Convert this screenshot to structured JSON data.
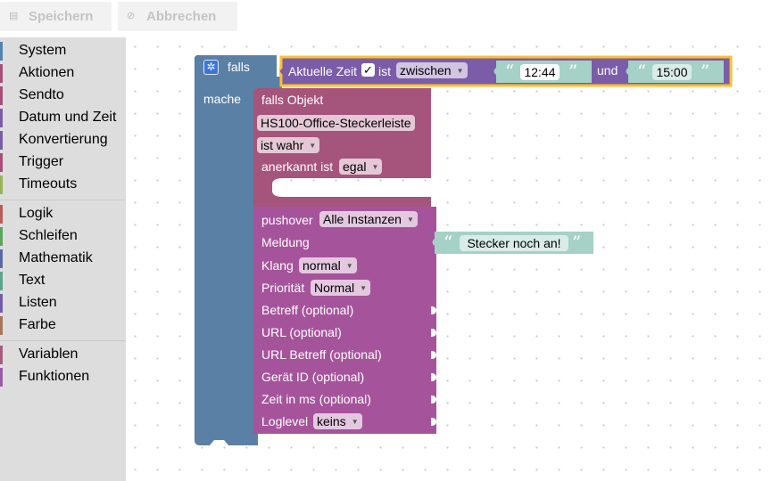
{
  "toolbar": {
    "save_label": "Speichern",
    "cancel_label": "Abbrechen",
    "save_icon": "floppy-icon",
    "cancel_icon": "ban-icon"
  },
  "sidebar": {
    "items": [
      {
        "label": "System",
        "color": "#4f83b0"
      },
      {
        "label": "Aktionen",
        "color": "#a64d79"
      },
      {
        "label": "Sendto",
        "color": "#a64d79"
      },
      {
        "label": "Datum und Zeit",
        "color": "#7a5ca8"
      },
      {
        "label": "Konvertierung",
        "color": "#7a5ca8"
      },
      {
        "label": "Trigger",
        "color": "#a64d79"
      },
      {
        "label": "Timeouts",
        "color": "#98b45b"
      },
      {
        "label": "Logik",
        "color": "#b85c5c"
      },
      {
        "label": "Schleifen",
        "color": "#5ba55b"
      },
      {
        "label": "Mathematik",
        "color": "#5b67a5"
      },
      {
        "label": "Text",
        "color": "#5ba58c"
      },
      {
        "label": "Listen",
        "color": "#745ba5"
      },
      {
        "label": "Farbe",
        "color": "#a5745b"
      },
      {
        "label": "Variablen",
        "color": "#a55b80"
      },
      {
        "label": "Funktionen",
        "color": "#995ba5"
      }
    ]
  },
  "blocks": {
    "if_block": {
      "if_label": "falls",
      "do_label": "mache",
      "color": "#5b80a5"
    },
    "time_compare": {
      "label": "Aktuelle Zeit",
      "check": "✓",
      "is_label": "ist",
      "operator": "zwischen",
      "and_label": "und",
      "start_time": "12:44",
      "end_time": "15:00",
      "color": "#7a5ca8",
      "highlight": "#fcc02e"
    },
    "on_object": {
      "label": "falls Objekt",
      "object_id": "HS100-Office-Steckerleiste",
      "condition": "ist wahr",
      "ack_label": "anerkannt ist",
      "ack_value": "egal",
      "color": "#a5547b"
    },
    "pushover": {
      "label": "pushover",
      "instance": "Alle Instanzen",
      "message_label": "Meldung",
      "message_text": "Stecker noch an!",
      "sound_label": "Klang",
      "sound_value": "normal",
      "priority_label": "Priorität",
      "priority_value": "Normal",
      "subject_label": "Betreff (optional)",
      "url_label": "URL (optional)",
      "url_title_label": "URL Betreff (optional)",
      "device_label": "Gerät ID (optional)",
      "time_label": "Zeit in ms (optional)",
      "loglevel_label": "Loglevel",
      "loglevel_value": "keins",
      "color": "#a5549b"
    },
    "text_color": "#a5d1c6"
  }
}
